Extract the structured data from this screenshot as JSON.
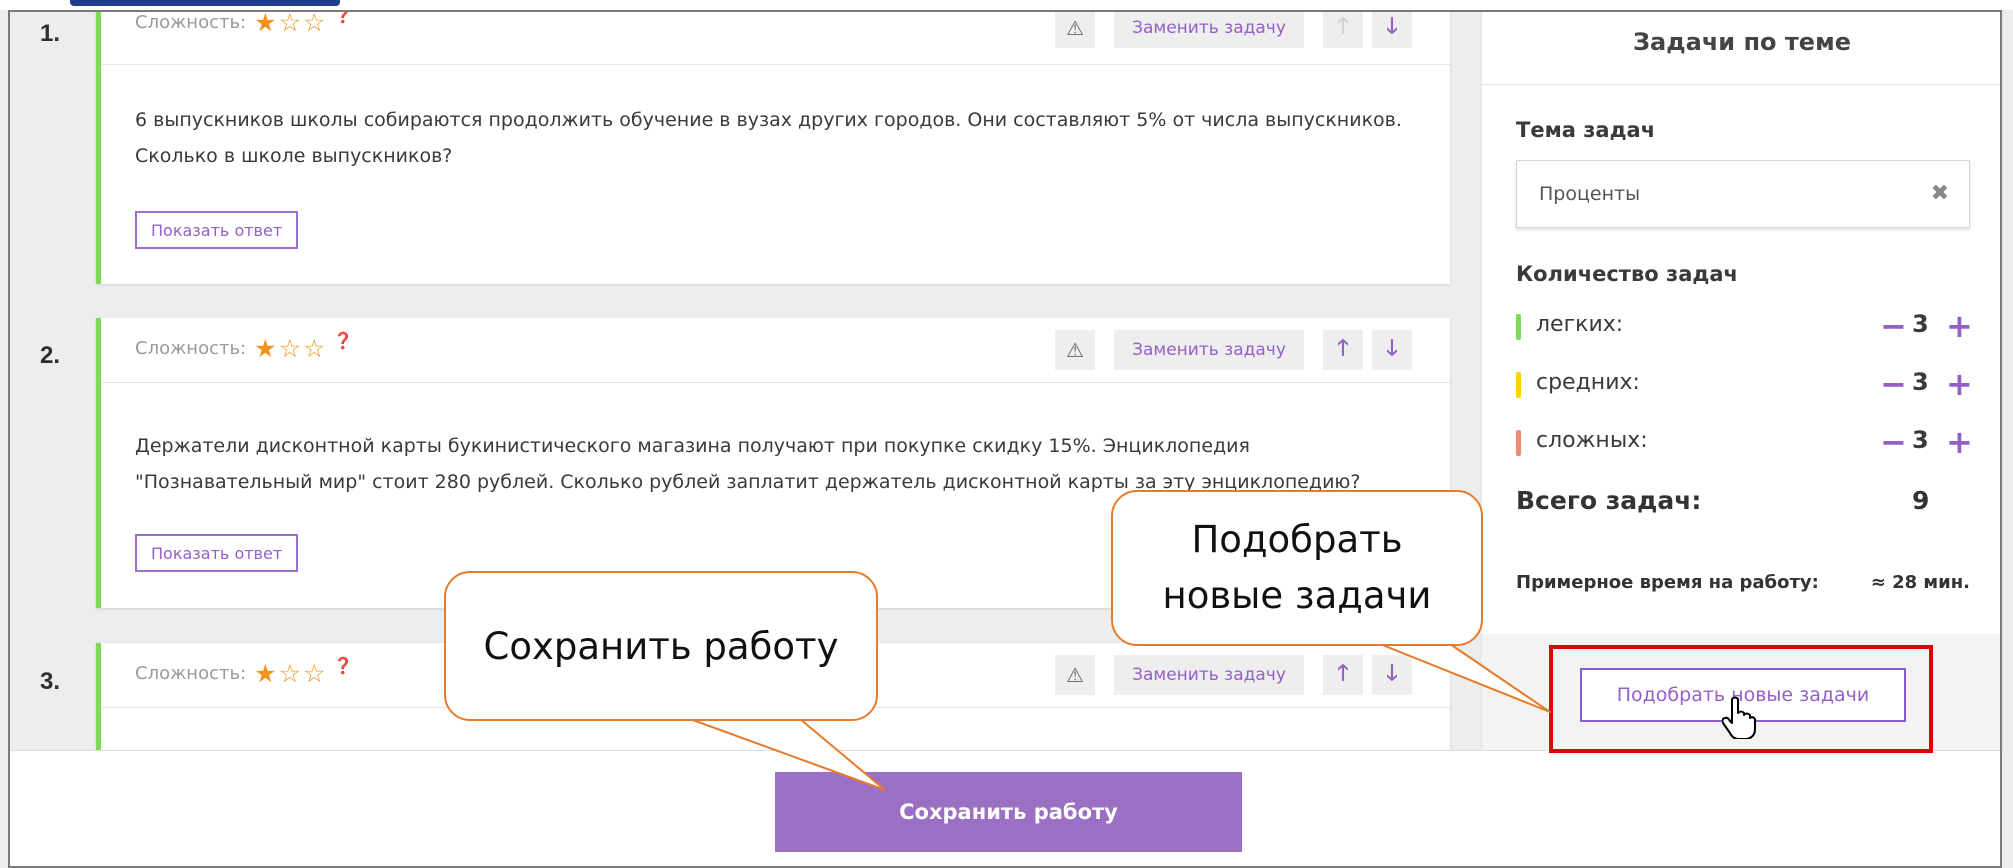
{
  "tasks": [
    {
      "number": "1.",
      "difficulty_label": "Сложность:",
      "stars_filled": 1,
      "stars_total": 3,
      "replace_label": "Заменить задачу",
      "text": "6 выпускников школы собираются продолжить обучение в вузах других городов. Они составляют 5% от числа выпускников. Сколько в школе выпускников?",
      "show_answer_label": "Показать ответ",
      "up_disabled": true
    },
    {
      "number": "2.",
      "difficulty_label": "Сложность:",
      "stars_filled": 1,
      "stars_total": 3,
      "replace_label": "Заменить задачу",
      "text": "Держатели дисконтной карты букинистического магазина получают при покупке скидку 15%. Энциклопедия \"Познавательный мир\" стоит 280 рублей. Сколько рублей заплатит держатель дисконтной карты за эту энциклопедию?",
      "show_answer_label": "Показать ответ",
      "up_disabled": false
    },
    {
      "number": "3.",
      "difficulty_label": "Сложность:",
      "stars_filled": 1,
      "stars_total": 3,
      "replace_label": "Заменить задачу",
      "up_disabled": false
    }
  ],
  "sidebar": {
    "title": "Задачи по теме",
    "topic_label": "Тема задач",
    "topic_value": "Проценты",
    "count_label": "Количество задач",
    "levels": [
      {
        "label": "легких:",
        "count": "3",
        "color": "#7ed957"
      },
      {
        "label": "средних:",
        "count": "3",
        "color": "#ffd200"
      },
      {
        "label": "сложных:",
        "count": "3",
        "color": "#f08a78"
      }
    ],
    "total_label": "Всего задач:",
    "total_value": "9",
    "time_label": "Примерное время на работу:",
    "time_value": "≈ 28 мин.",
    "pick_button": "Подобрать новые задачи"
  },
  "bottom": {
    "save_button": "Сохранить работу"
  },
  "callouts": {
    "save": "Сохранить работу",
    "pick_line1": "Подобрать",
    "pick_line2": "новые задачи"
  },
  "colors": {
    "accent": "#9460c7",
    "save_button_bg": "#9a6fc4",
    "card_border": "#7ed957",
    "star": "#f0941f",
    "callout_border": "#e87b2b",
    "highlight": "#e30000"
  }
}
